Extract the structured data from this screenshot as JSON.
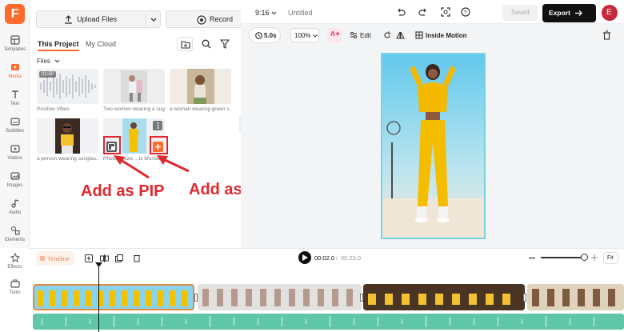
{
  "app": {
    "logo": "F",
    "project_name": "Untitled",
    "aspect_ratio": "9:16",
    "saved_label": "Saved",
    "export_label": "Export",
    "avatar_initial": "E",
    "brand_color": "#ff6b2c"
  },
  "sidebar": {
    "items": [
      {
        "label": "Templates",
        "icon": "templates-icon"
      },
      {
        "label": "Media",
        "icon": "media-icon",
        "active": true
      },
      {
        "label": "Text",
        "icon": "text-icon"
      },
      {
        "label": "Subtitles",
        "icon": "subtitles-icon"
      },
      {
        "label": "Videos",
        "icon": "videos-icon"
      },
      {
        "label": "Images",
        "icon": "images-icon"
      },
      {
        "label": "Audio",
        "icon": "audio-icon"
      },
      {
        "label": "Elements",
        "icon": "elements-icon"
      },
      {
        "label": "Effects",
        "icon": "effects-icon"
      },
      {
        "label": "Tools",
        "icon": "tools-icon"
      }
    ]
  },
  "panel": {
    "upload_label": "Upload Files",
    "record_label": "Record",
    "tabs": [
      {
        "label": "This Project"
      },
      {
        "label": "My Cloud"
      }
    ],
    "files_label": "Files",
    "files": [
      {
        "caption": "Positive Vibes",
        "duration": "01:50"
      },
      {
        "caption": "Two women wearing a sug..."
      },
      {
        "caption": "a woman wearing green s..."
      },
      {
        "caption": "a person wearing sunglas..."
      },
      {
        "caption": "Photo shows ...ts Montan..."
      }
    ]
  },
  "toolbar": {
    "duration": "5.0s",
    "zoom": "100%",
    "edit_label": "Edit",
    "inside_motion_label": "Inside Motion"
  },
  "timeline": {
    "label": "Timeline",
    "current_time": "00:02.0",
    "separator": "/",
    "total_time": "00:20.0",
    "fit_label": "Fit"
  },
  "annotations": {
    "pip": "Add as PIP",
    "scene": "Add as Scene"
  }
}
